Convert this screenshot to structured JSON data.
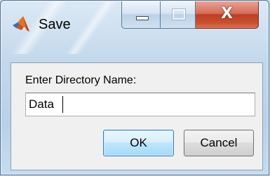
{
  "window": {
    "title": "Save",
    "app_icon": "matlab-logo-icon",
    "controls": {
      "minimize_icon": "minimize-icon",
      "maximize_icon": "maximize-icon",
      "close_icon": "close-icon",
      "close_glyph": "X"
    }
  },
  "dialog": {
    "prompt_label": "Enter Directory Name:",
    "input_value": "Data",
    "ok_label": "OK",
    "cancel_label": "Cancel"
  },
  "colors": {
    "close_button": "#c8502f",
    "default_button_border": "#3c7fb1"
  }
}
